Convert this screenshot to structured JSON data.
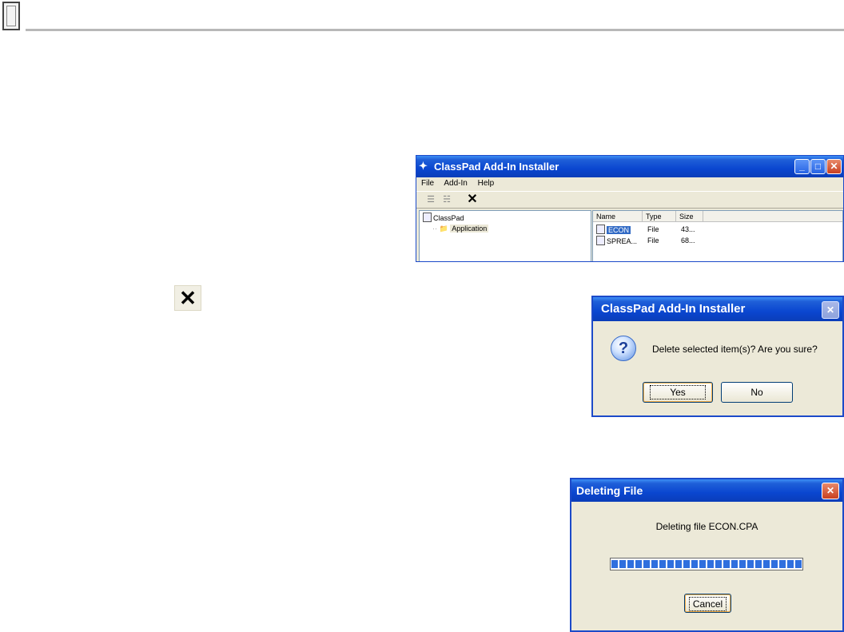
{
  "main_window": {
    "title": "ClassPad Add-In Installer",
    "title_buttons": [
      "minimize-icon",
      "maximize-icon",
      "close-icon"
    ],
    "menu": [
      "File",
      "Add-In",
      "Help"
    ],
    "toolbar": {
      "delete_glyph": "✕"
    },
    "tree": {
      "root": "ClassPad",
      "child": "Application"
    },
    "list": {
      "columns": [
        "Name",
        "Type",
        "Size"
      ],
      "rows": [
        {
          "name": "ECON",
          "type": "File",
          "size": "43...",
          "selected": true
        },
        {
          "name": "SPREA...",
          "type": "File",
          "size": "68...",
          "selected": false
        }
      ]
    }
  },
  "delete_icon": "✕",
  "confirm_dialog": {
    "title": "ClassPad Add-In Installer",
    "icon": "question-icon",
    "message": "Delete selected item(s)?  Are you sure?",
    "yes_label": "Yes",
    "no_label": "No"
  },
  "deleting_dialog": {
    "title": "Deleting File",
    "message": "Deleting file ECON.CPA",
    "progress_fraction": 1.0,
    "cancel_label": "Cancel"
  },
  "colors": {
    "xp_blue": "#0a46d0",
    "dialog_face": "#ece9d8",
    "progress_blue": "#2f6fde",
    "selection": "#316ac5"
  }
}
